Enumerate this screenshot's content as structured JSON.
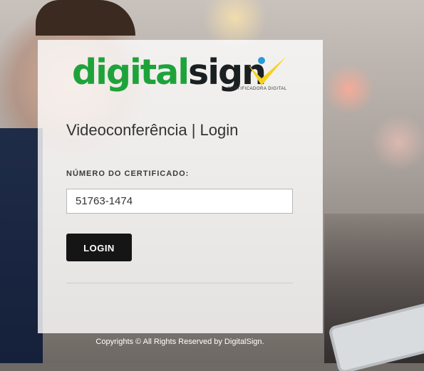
{
  "logo": {
    "brand_green": "digital",
    "brand_dark": "sign",
    "subtitle": "CERTIFICADORA DIGITAL",
    "colors": {
      "green": "#1ea33a",
      "dark": "#1a1f22",
      "check": "#f4d21f",
      "dot": "#2a9bd7"
    }
  },
  "login": {
    "title": "Videoconferência | Login",
    "field_label": "NÚMERO DO CERTIFICADO:",
    "certificate_value": "51763-1474",
    "button_label": "LOGIN"
  },
  "footer": {
    "copyright": "Copyrights © All Rights Reserved by DigitalSign."
  }
}
